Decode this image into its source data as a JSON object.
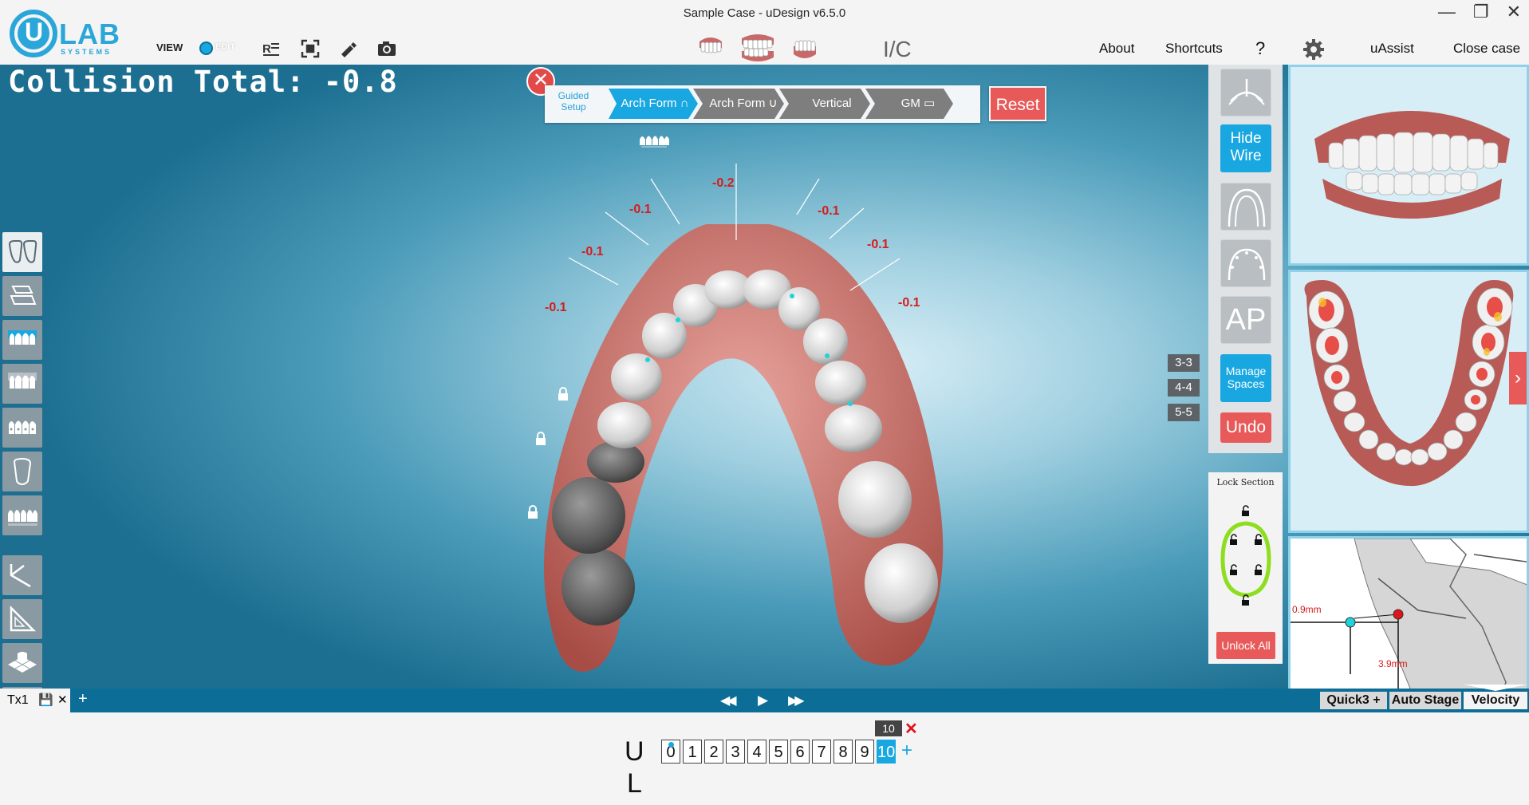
{
  "window": {
    "title": "Sample  Case - uDesign v6.5.0",
    "controls": [
      "—",
      "❐",
      "✕"
    ]
  },
  "logo": {
    "letter": "U",
    "text": "LAB",
    "sub": "SYSTEMS"
  },
  "toolbar": {
    "view": "VIEW",
    "edit": "EDIT",
    "ic": "I/C",
    "menu": {
      "about": "About",
      "shortcuts": "Shortcuts",
      "help": "?",
      "uassist": "uAssist",
      "close_case": "Close case"
    }
  },
  "collision_total": "Collision Total: -0.8",
  "guided_setup": {
    "label": "Guided Setup",
    "steps": [
      "Arch Form",
      "Arch Form",
      "Vertical",
      "GM"
    ],
    "reset": "Reset"
  },
  "collisions": [
    "-0.2",
    "-0.1",
    "-0.1",
    "-0.1",
    "-0.1",
    "-0.1",
    "-0.1"
  ],
  "segment_buttons": [
    "3-3",
    "4-4",
    "5-5"
  ],
  "right_tools": {
    "hide_wire": [
      "Hide",
      "Wire"
    ],
    "ap": "AP",
    "manage_spaces": [
      "Manage",
      "Spaces"
    ],
    "undo": "Undo"
  },
  "lock_section": {
    "title": "Lock Section",
    "unlock_all": "Unlock All"
  },
  "measurements": {
    "left": "0.9mm",
    "bottom": "3.9mm"
  },
  "stage_bar": {
    "tab": "Tx1",
    "add": "+",
    "rewind": "◀◀",
    "play": "▶",
    "forward": "▶▶",
    "quick3": "Quick3 +",
    "auto_stage": "Auto Stage",
    "velocity": "Velocity"
  },
  "staging": {
    "current_badge": "10",
    "upper": "U",
    "lower": "L",
    "stages": [
      "0",
      "1",
      "2",
      "3",
      "4",
      "5",
      "6",
      "7",
      "8",
      "9",
      "10"
    ],
    "selected_stage": "10",
    "add": "+"
  },
  "colors": {
    "accent_blue": "#19a7e1",
    "danger_red": "#e85a5a",
    "collision_red": "#d51d1d",
    "stage_bar": "#0c6d96"
  }
}
